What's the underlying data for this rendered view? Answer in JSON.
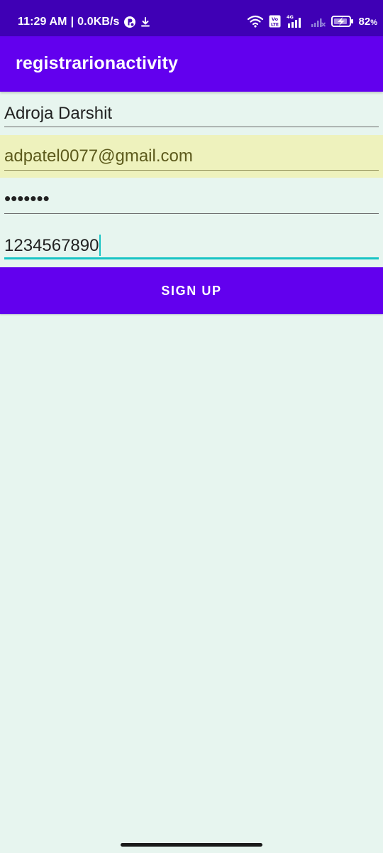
{
  "status_bar": {
    "time": "11:29 AM",
    "network_speed": "0.0KB/s",
    "separator": "|",
    "net_badge": "4G",
    "volte_badge": "Vo LTE",
    "battery": "82",
    "battery_unit": "%",
    "icons": [
      "app-notification-icon",
      "download-icon",
      "wifi-icon",
      "volte-icon",
      "signal-icon",
      "no-signal-icon",
      "battery-charging-icon"
    ]
  },
  "app_bar": {
    "title": "registrarionactivity"
  },
  "form": {
    "name_value": "Adroja Darshit",
    "email_value": "adpatel0077@gmail.com",
    "password_value": "•••••••",
    "phone_value": "1234567890"
  },
  "signup_button": {
    "label": "SIGN UP"
  },
  "colors": {
    "status_bar": "#3f00b5",
    "app_bar": "#6200ee",
    "button": "#6200ee",
    "background": "#e7f5ef",
    "autofill": "#eef2bd",
    "focus_accent": "#18c4c4"
  }
}
